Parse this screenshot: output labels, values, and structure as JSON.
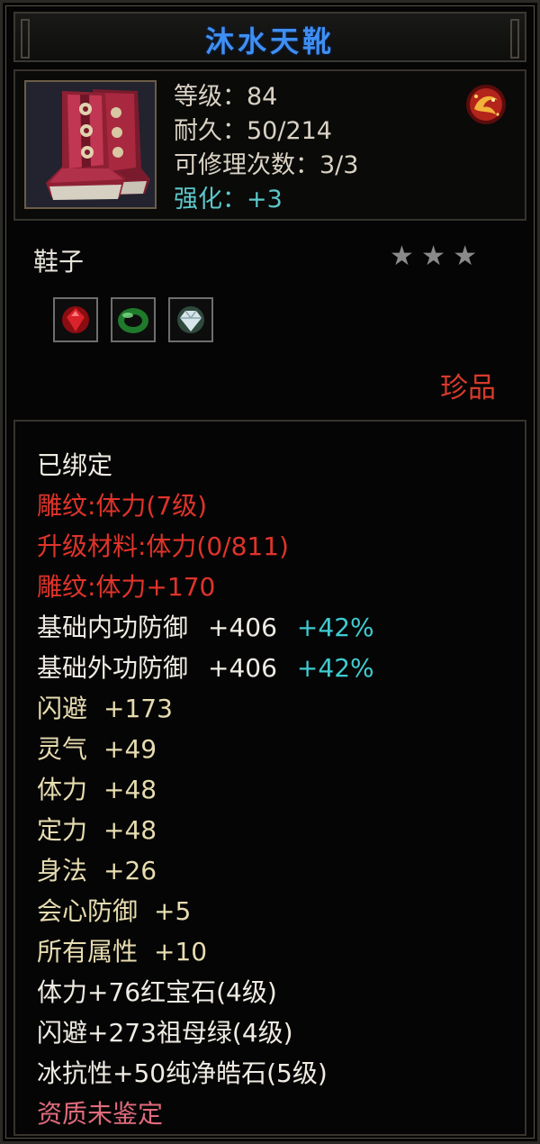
{
  "item": {
    "name": "沐水天靴",
    "level_row": "等级：84",
    "durability_row": "耐久：50/214",
    "repair_row": "可修理次数：3/3",
    "enhance_row": "强化：+3",
    "type": "鞋子",
    "rarity": "珍品",
    "stars_filled": 0,
    "stars_total": 3
  },
  "icons": {
    "item": "boots-icon",
    "emblem": "dragon-emblem-icon",
    "star": "star-icon",
    "gems": [
      "ruby-gem-icon",
      "emerald-ring-gem-icon",
      "diamond-gem-icon"
    ]
  },
  "details": {
    "bound": "已绑定",
    "engrave_level": "雕纹:体力(7级)",
    "upgrade_material": "升级材料:体力(0/811)",
    "engrave_bonus": "雕纹:体力+170",
    "base_attrs": [
      {
        "label": "基础内功防御",
        "value": "+406",
        "pct": "+42%"
      },
      {
        "label": "基础外功防御",
        "value": "+406",
        "pct": "+42%"
      }
    ],
    "extra_attrs": [
      {
        "label": "闪避",
        "value": "+173"
      },
      {
        "label": "灵气",
        "value": "+49"
      },
      {
        "label": "体力",
        "value": "+48"
      },
      {
        "label": "定力",
        "value": "+48"
      },
      {
        "label": "身法",
        "value": "+26"
      },
      {
        "label": "会心防御",
        "value": "+5"
      },
      {
        "label": "所有属性",
        "value": "+10"
      }
    ],
    "gem_lines": [
      "体力+76红宝石(4级)",
      "闪避+273祖母绿(4级)",
      "冰抗性+50纯净皓石(5级)"
    ],
    "quality": "资质未鉴定"
  },
  "colors": {
    "title": "#3f8ff2",
    "enhance": "#5cc7c9",
    "red_text": "#e0332a",
    "attr_text": "#e7dcb0",
    "percent": "#3fcbd2",
    "quality": "#e06b7c",
    "rarity": "#d83a2c"
  }
}
